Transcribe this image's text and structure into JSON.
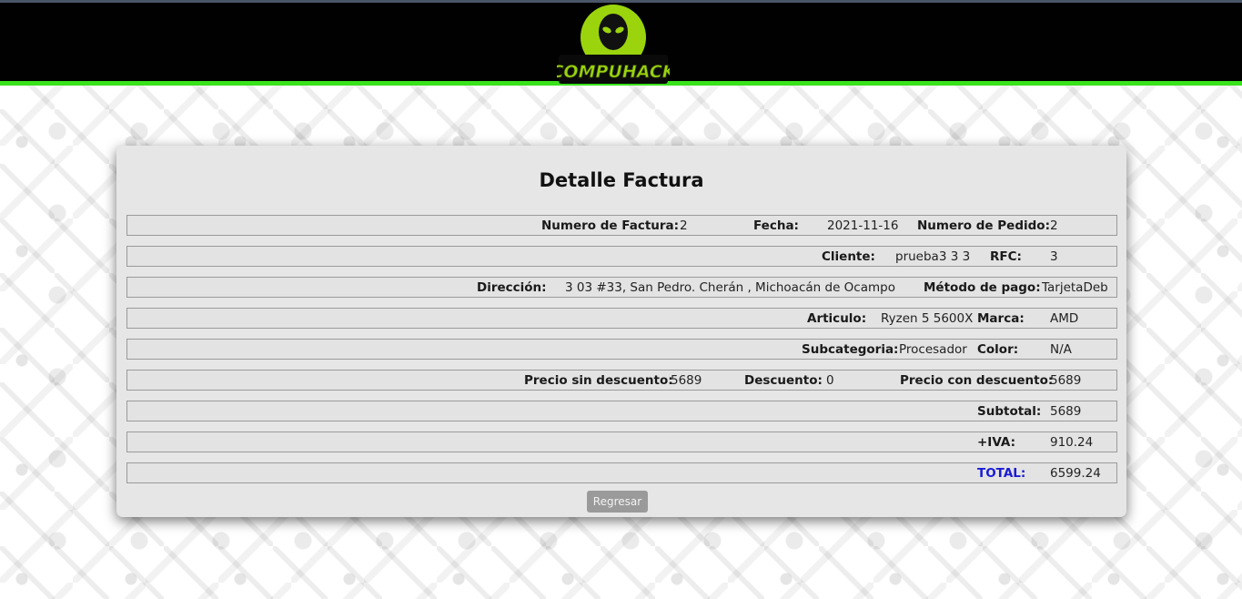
{
  "header": {
    "logo_text": "COMPUHACK",
    "colors": {
      "background": "#010101",
      "accent_border": "#39e21b",
      "logo_green": "#9bd40d"
    }
  },
  "invoice": {
    "title": "Detalle Factura",
    "numero_factura_label": "Numero de Factura:",
    "numero_factura": "2",
    "fecha_label": "Fecha:",
    "fecha": "2021-11-16",
    "numero_pedido_label": "Numero de Pedido:",
    "numero_pedido": "2",
    "cliente_label": "Cliente:",
    "cliente": "prueba3 3 3",
    "rfc_label": "RFC:",
    "rfc": "3",
    "direccion_label": "Dirección:",
    "direccion": "3 03 #33, San Pedro. Cherán , Michoacán de Ocampo",
    "metodo_pago_label": "Método de pago:",
    "metodo_pago": "TarjetaDeb",
    "articulo_label": "Articulo:",
    "articulo": "Ryzen 5 5600X",
    "marca_label": "Marca:",
    "marca": "AMD",
    "subcategoria_label": "Subcategoria:",
    "subcategoria": "Procesador",
    "color_label": "Color:",
    "color": "N/A",
    "precio_sin_desc_label": "Precio sin descuento:",
    "precio_sin_desc": "5689",
    "descuento_label": "Descuento:",
    "descuento": "0",
    "precio_con_desc_label": "Precio con descuento:",
    "precio_con_desc": "5689",
    "subtotal_label": "Subtotal:",
    "subtotal": "5689",
    "iva_label": "+IVA:",
    "iva": "910.24",
    "total_label": "TOTAL:",
    "total": "6599.24",
    "total_color": "#1a1ad6"
  },
  "actions": {
    "back_label": "Regresar"
  }
}
